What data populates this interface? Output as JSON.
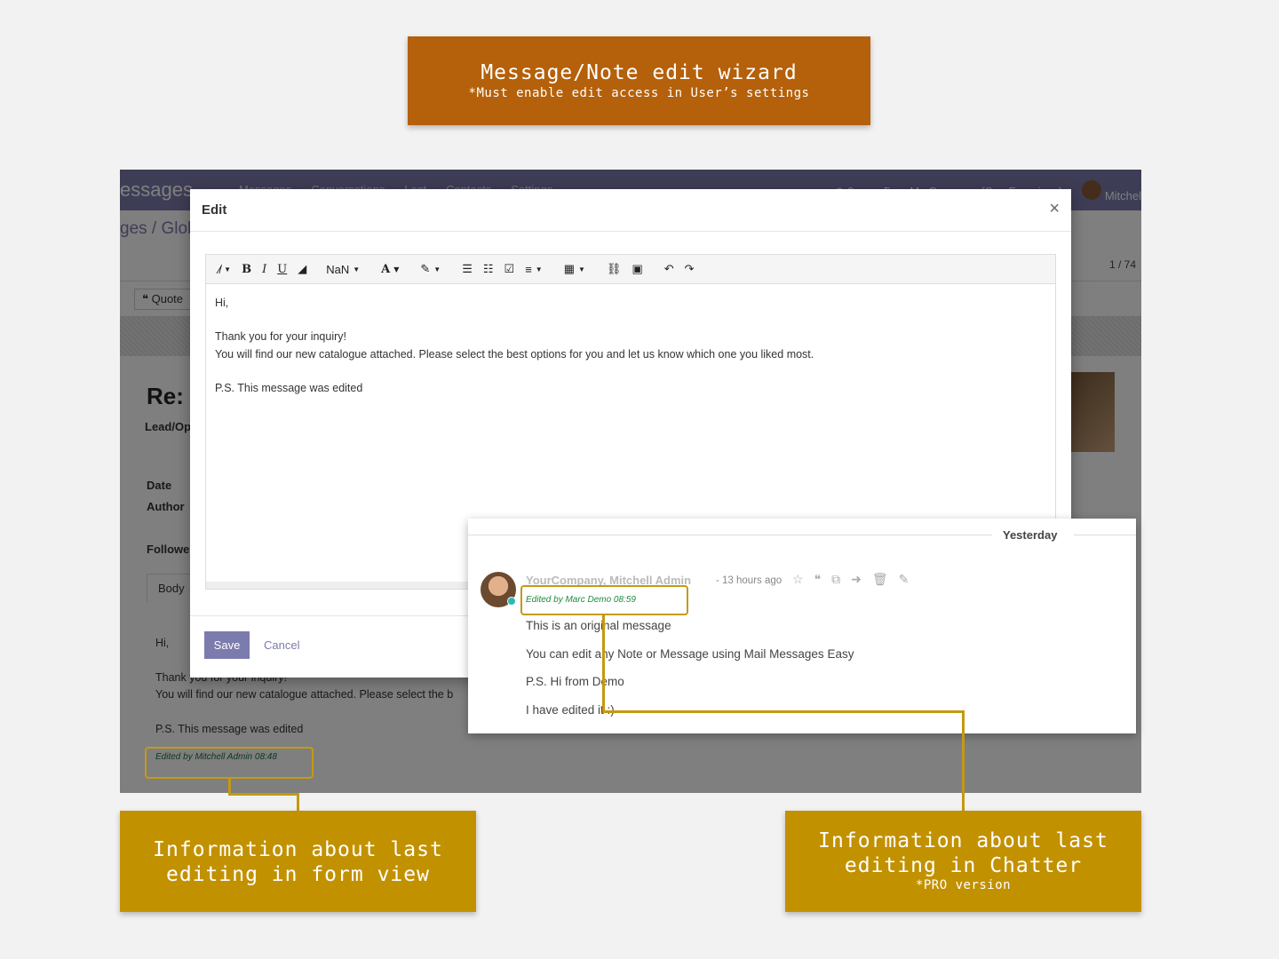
{
  "top_banner": {
    "title": "Message/Note edit wizard",
    "subtitle": "*Must enable edit access in User’s settings"
  },
  "app": {
    "brand": "essages",
    "nav_links": [
      "Messages",
      "Conversations",
      "Lost",
      "Contacts",
      "Settings"
    ],
    "company": "My Company (San Francisco)",
    "user": "Mitchel",
    "badge_counts": [
      "9",
      "5"
    ],
    "breadcrumb": "ges / Glob",
    "pager": "1 / 74",
    "quote_button": "Quote",
    "record_title": "Re:",
    "lead_label": "Lead/Op",
    "labels": {
      "date": "Date",
      "author": "Author",
      "followers": "Followe"
    },
    "body_tab": "Body",
    "body_lines": [
      "Hi,",
      "Thank you for your inquiry!",
      "You will find our new catalogue attached. Please select the b",
      "P.S. This message was edited"
    ],
    "edited_note": "Edited by Mitchell Admin 08:48"
  },
  "modal": {
    "title": "Edit",
    "close_glyph": "×",
    "toolbar": {
      "font_size": "NaN"
    },
    "content_lines": [
      "Hi,",
      "",
      "Thank you for your inquiry!",
      "You will find our new catalogue attached. Please select the best options for you and let us know which one you liked most.",
      "",
      "P.S. This message was edited"
    ],
    "save_label": "Save",
    "cancel_label": "Cancel"
  },
  "chatter": {
    "day": "Yesterday",
    "author": "YourCompany, Mitchell Admin",
    "ago": "- 13 hours ago",
    "edited_note": "Edited by Marc Demo 08:59",
    "lines": [
      "This is an original message",
      "You can edit any Note or Message using Mail Messages Easy",
      "P.S. Hi from Demo",
      "I have edited it :)"
    ]
  },
  "callouts": {
    "form": {
      "title": "Information about last editing in form view"
    },
    "chatter": {
      "title": "Information about last editing in Chatter",
      "subtitle": "*PRO version"
    }
  },
  "colors": {
    "banner": "#b5600a",
    "callout": "#c29100",
    "highlight": "#c49a12",
    "brand": "#7c7bad",
    "edited_text": "#1f8a3c"
  }
}
